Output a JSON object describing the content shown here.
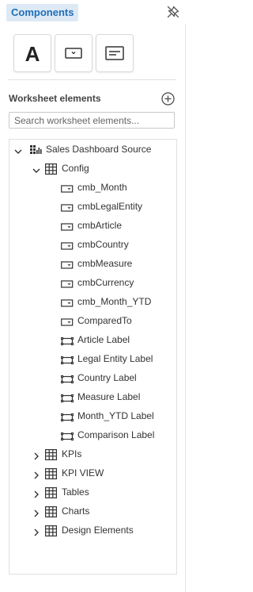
{
  "header": {
    "tab_label": "Components",
    "pin_icon": "pin-off-icon"
  },
  "component_types": [
    {
      "name": "text",
      "icon": "text-component-icon",
      "glyph": "A"
    },
    {
      "name": "dropdown",
      "icon": "dropdown-component-icon"
    },
    {
      "name": "label",
      "icon": "label-component-icon"
    }
  ],
  "worksheet": {
    "title": "Worksheet elements",
    "add_icon": "add-circle-icon",
    "search_placeholder": "Search worksheet elements..."
  },
  "tree": {
    "root": {
      "label": "Sales Dashboard Source",
      "icon": "datasource-icon",
      "expanded": true
    },
    "config": {
      "label": "Config",
      "icon": "table-icon",
      "expanded": true,
      "items": [
        {
          "label": "cmb_Month",
          "icon": "combobox-icon"
        },
        {
          "label": "cmbLegalEntity",
          "icon": "combobox-icon"
        },
        {
          "label": "cmbArticle",
          "icon": "combobox-icon"
        },
        {
          "label": "cmbCountry",
          "icon": "combobox-icon"
        },
        {
          "label": "cmbMeasure",
          "icon": "combobox-icon"
        },
        {
          "label": "cmbCurrency",
          "icon": "combobox-icon"
        },
        {
          "label": "cmb_Month_YTD",
          "icon": "combobox-icon"
        },
        {
          "label": "ComparedTo",
          "icon": "combobox-icon"
        },
        {
          "label": "Article Label",
          "icon": "label-icon"
        },
        {
          "label": "Legal Entity Label",
          "icon": "label-icon"
        },
        {
          "label": "Country Label",
          "icon": "label-icon"
        },
        {
          "label": "Measure Label",
          "icon": "label-icon"
        },
        {
          "label": "Month_YTD Label",
          "icon": "label-icon"
        },
        {
          "label": "Comparison Label",
          "icon": "label-icon"
        }
      ]
    },
    "folders": [
      {
        "label": "KPIs",
        "icon": "table-icon",
        "expanded": false
      },
      {
        "label": "KPI VIEW",
        "icon": "table-icon",
        "expanded": false
      },
      {
        "label": "Tables",
        "icon": "table-icon",
        "expanded": false
      },
      {
        "label": "Charts",
        "icon": "table-icon",
        "expanded": false
      },
      {
        "label": "Design Elements",
        "icon": "table-icon",
        "expanded": false
      }
    ]
  },
  "colors": {
    "accent": "#1f6fb8",
    "tab_bg": "#dde9f5",
    "icon": "#333333"
  }
}
